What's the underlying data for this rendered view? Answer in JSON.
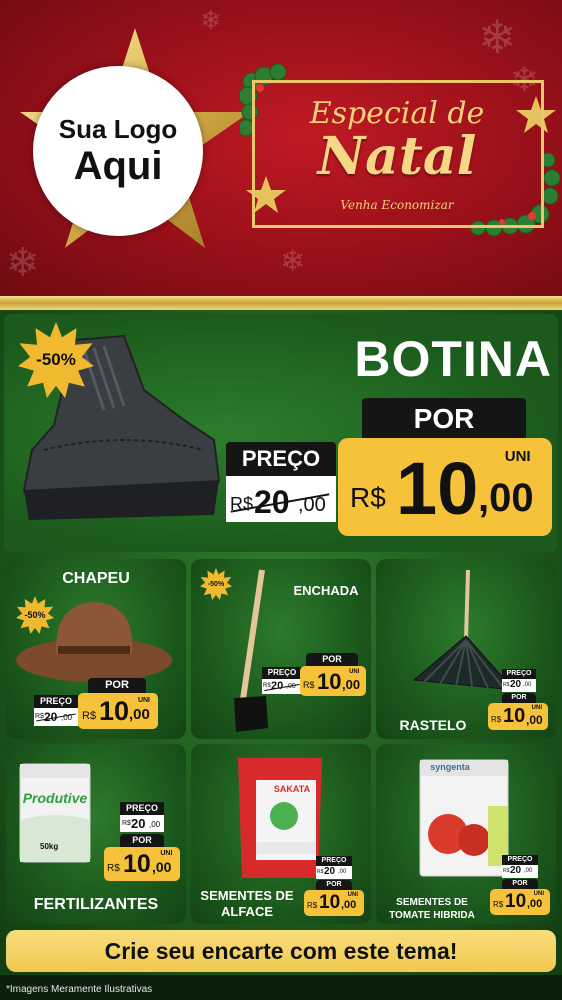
{
  "header": {
    "logo_line1": "Sua Logo",
    "logo_line2": "Aqui",
    "title_small": "Especial de",
    "title_big": "Natal",
    "title_sub": "Venha Economizar"
  },
  "hero": {
    "badge": "-50%",
    "title": "BOTINA",
    "por_label": "POR",
    "preco_label": "PREÇO",
    "old_currency": "R$",
    "old_int": "20",
    "old_cents": ",00",
    "uni": "UNI",
    "currency": "R$",
    "price_int": "10",
    "price_cents": ",00"
  },
  "products": [
    {
      "name": "CHAPEU",
      "badge": "-50%",
      "preco_label": "PREÇO",
      "old_currency": "R$",
      "old_int": "20",
      "old_cents": ",00",
      "por_label": "POR",
      "uni": "UNI",
      "currency": "R$",
      "price_int": "10",
      "price_cents": ",00"
    },
    {
      "name": "ENCHADA",
      "badge": "-50%",
      "preco_label": "PREÇO",
      "old_currency": "R$",
      "old_int": "20",
      "old_cents": ",00",
      "por_label": "POR",
      "uni": "UNI",
      "currency": "R$",
      "price_int": "10",
      "price_cents": ",00"
    },
    {
      "name": "RASTELO",
      "preco_label": "PREÇO",
      "old_currency": "R$",
      "old_int": "20",
      "old_cents": ",00",
      "por_label": "POR",
      "uni": "UNI",
      "currency": "R$",
      "price_int": "10",
      "price_cents": ",00"
    },
    {
      "name": "FERTILIZANTES",
      "preco_label": "PREÇO",
      "old_currency": "R$",
      "old_int": "20",
      "old_cents": ",00",
      "por_label": "POR",
      "uni": "UNI",
      "currency": "R$",
      "price_int": "10",
      "price_cents": ",00",
      "bag_brand": "Produtive",
      "bag_weight": "50kg"
    },
    {
      "name_line1": "SEMENTES DE",
      "name_line2": "ALFACE",
      "preco_label": "PREÇO",
      "old_currency": "R$",
      "old_int": "20",
      "old_cents": ",00",
      "por_label": "POR",
      "uni": "UNI",
      "currency": "R$",
      "price_int": "10",
      "price_cents": ",00",
      "pack_brand": "SAKATA"
    },
    {
      "name_line1": "SEMENTES DE",
      "name_line2": "TOMATE HIBRIDA",
      "preco_label": "PREÇO",
      "old_currency": "R$",
      "old_int": "20",
      "old_cents": ",00",
      "por_label": "POR",
      "uni": "UNI",
      "currency": "R$",
      "price_int": "10",
      "price_cents": ",00",
      "pack_brand": "syngenta"
    }
  ],
  "cta": "Crie seu encarte com este tema!",
  "footnote": "*Imagens Meramente Ilustrativas",
  "colors": {
    "header_red": "#a3121c",
    "gold": "#f6c23a",
    "green": "#1d5a1d",
    "dark": "#151515"
  }
}
